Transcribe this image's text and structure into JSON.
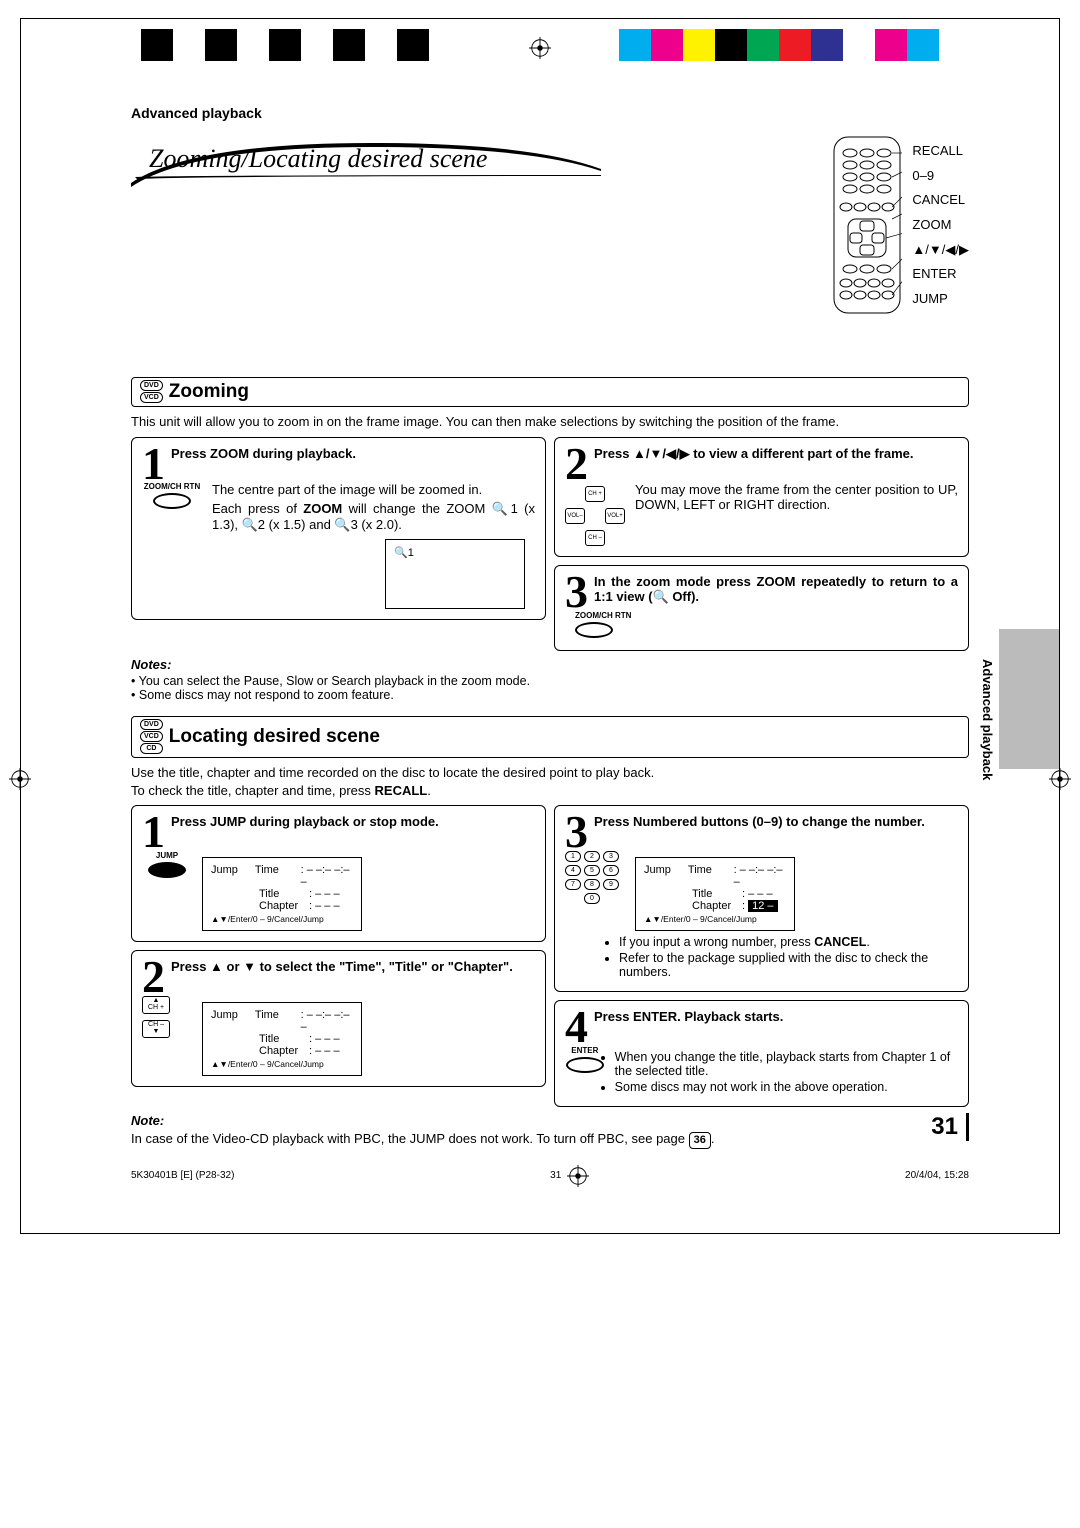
{
  "header": {
    "section": "Advanced playback"
  },
  "title": "Zooming/Locating desired scene",
  "remote_labels": [
    "RECALL",
    "0–9",
    "CANCEL",
    "ZOOM",
    "▲/▼/◀/▶",
    "ENTER",
    "JUMP"
  ],
  "zooming": {
    "badges": [
      "DVD",
      "VCD"
    ],
    "heading": "Zooming",
    "intro": "This unit will allow you to zoom in on the frame image. You can then make selections by switching the position of the frame.",
    "step1": {
      "num": "1",
      "head": "Press ZOOM during playback.",
      "btn_label": "ZOOM/CH RTN",
      "body1": "The centre part of the image will be zoomed in.",
      "body2_a": "Each press of ",
      "body2_bold": "ZOOM",
      "body2_b": " will change the ZOOM 🔍1 (x 1.3), 🔍2 (x 1.5) and 🔍3 (x 2.0).",
      "screen": "🔍1"
    },
    "step2": {
      "num": "2",
      "head": "Press ▲/▼/◀/▶ to view a different part of the frame.",
      "body": "You may move the frame from the center position to UP, DOWN, LEFT or RIGHT direction.",
      "dpad": {
        "up": "▲",
        "dn": "▼",
        "lf": "◀ VOL –",
        "rt": "VOL + ▶",
        "up_lbl": "CH +",
        "dn_lbl": "CH –"
      }
    },
    "step3": {
      "num": "3",
      "head": "In the zoom mode press ZOOM repeatedly to return to a 1:1 view (🔍 Off).",
      "btn_label": "ZOOM/CH RTN"
    },
    "notes_h": "Notes:",
    "notes": [
      "You can select the Pause, Slow or Search playback in the zoom mode.",
      "Some discs may not respond to zoom feature."
    ]
  },
  "locating": {
    "badges": [
      "DVD",
      "VCD",
      "CD"
    ],
    "heading": "Locating desired scene",
    "intro1": "Use the title, chapter and time recorded on the disc to locate the desired point to play back.",
    "intro2_a": "To check the title, chapter and time, press ",
    "intro2_bold": "RECALL",
    "intro2_b": ".",
    "step1": {
      "num": "1",
      "head": "Press JUMP during playback or stop mode.",
      "btn_label": "JUMP",
      "screen": {
        "c1": "Jump",
        "rows": [
          [
            "Time",
            ": – –:– –:– –"
          ],
          [
            "Title",
            ": – – –"
          ],
          [
            "Chapter",
            ": – – –"
          ]
        ],
        "hint": "▲▼/Enter/0 – 9/Cancel/Jump"
      }
    },
    "step2": {
      "num": "2",
      "head": "Press ▲ or ▼ to select the \"Time\", \"Title\" or \"Chapter\".",
      "btns": {
        "up": "▲",
        "dn": "▼",
        "up_lbl": "CH +",
        "dn_lbl": "CH –"
      },
      "screen": {
        "c1": "Jump",
        "rows": [
          [
            "Time",
            ": – –:– –:– –"
          ],
          [
            "Title",
            ": – – –"
          ],
          [
            "Chapter",
            ": – – –"
          ]
        ],
        "hint": "▲▼/Enter/0 – 9/Cancel/Jump"
      }
    },
    "step3": {
      "num": "3",
      "head": "Press Numbered buttons (0–9) to change the number.",
      "screen": {
        "c1": "Jump",
        "rows": [
          [
            "Time",
            ": – –:– –:– –"
          ],
          [
            "Title",
            ": – – –"
          ],
          [
            "Chapter",
            ": 12 –"
          ]
        ],
        "hint": "▲▼/Enter/0 – 9/Cancel/Jump"
      },
      "bul1_a": "If you input a wrong number, press ",
      "bul1_bold": "CANCEL",
      "bul1_b": ".",
      "bul2": "Refer to the package supplied with the disc to check the numbers."
    },
    "step4": {
      "num": "4",
      "head": "Press ENTER. Playback starts.",
      "btn_label": "ENTER",
      "bul1": "When you change the title, playback starts from Chapter 1 of the selected title.",
      "bul2": "Some discs may not work in the above operation."
    },
    "note_h": "Note:",
    "note_a": "In case of the Video-CD playback with PBC, the JUMP does not work. To turn off PBC, see page ",
    "note_page": "36",
    "note_b": "."
  },
  "side_tab": "Advanced playback",
  "page_number": "31",
  "footer": {
    "left": "5K30401B [E] (P28-32)",
    "mid": "31",
    "right": "20/4/04, 15:28"
  },
  "colors": {
    "left": [
      "#000",
      "#fff",
      "#000",
      "#fff",
      "#000",
      "#fff",
      "#000",
      "#fff",
      "#000"
    ],
    "right": [
      "#00aeef",
      "#ec008c",
      "#fff200",
      "#000",
      "#00a651",
      "#ed1c24",
      "#2e3192",
      "#fff",
      "#ec008c",
      "#00aeef"
    ]
  }
}
